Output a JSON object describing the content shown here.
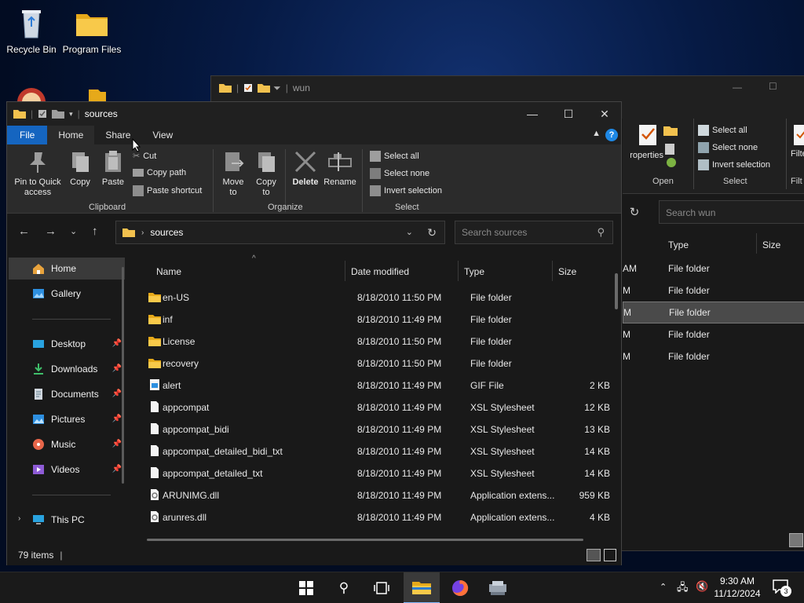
{
  "desktop": {
    "icons": [
      {
        "label": "Recycle Bin"
      },
      {
        "label": "Program Files"
      }
    ]
  },
  "bg_window": {
    "path": "wun",
    "ribbon": {
      "properties": "roperties",
      "open_label": "Open",
      "select_all": "Select all",
      "select_none": "Select none",
      "invert_selection": "Invert selection",
      "select_label": "Select",
      "filter": "Filte",
      "filter_group": "Filt"
    },
    "search_placeholder": "Search wun",
    "columns": {
      "type": "Type",
      "size": "Size"
    },
    "rows": [
      {
        "modified_tail": "AM",
        "type": "File folder"
      },
      {
        "modified_tail": "M",
        "type": "File folder"
      },
      {
        "modified_tail": "M",
        "type": "File folder"
      },
      {
        "modified_tail": "M",
        "type": "File folder"
      },
      {
        "modified_tail": "M",
        "type": "File folder"
      }
    ]
  },
  "window": {
    "title": "sources",
    "controls": {
      "minimize": "—",
      "maximize": "☐",
      "close": "✕"
    },
    "tabs": [
      {
        "label": "File"
      },
      {
        "label": "Home"
      },
      {
        "label": "Share"
      },
      {
        "label": "View"
      }
    ],
    "help": "?",
    "ribbon": {
      "pin": "Pin to Quick access",
      "copy": "Copy",
      "paste": "Paste",
      "cut": "Cut",
      "copy_path": "Copy path",
      "paste_shortcut": "Paste shortcut",
      "clipboard": "Clipboard",
      "move_to": "Move to",
      "copy_to": "Copy to",
      "delete": "Delete",
      "rename": "Rename",
      "organize": "Organize",
      "select_all": "Select all",
      "select_none": "Select none",
      "invert_selection": "Invert selection",
      "select": "Select"
    },
    "address": {
      "crumb": "sources"
    },
    "search": {
      "placeholder": "Search sources"
    },
    "nav_pane": {
      "items": [
        {
          "label": "Home"
        },
        {
          "label": "Gallery"
        },
        {
          "label": "Desktop"
        },
        {
          "label": "Downloads"
        },
        {
          "label": "Documents"
        },
        {
          "label": "Pictures"
        },
        {
          "label": "Music"
        },
        {
          "label": "Videos"
        },
        {
          "label": "This PC"
        }
      ]
    },
    "columns": {
      "name": "Name",
      "date": "Date modified",
      "type": "Type",
      "size": "Size"
    },
    "files": [
      {
        "name": "en-US",
        "date": "8/18/2010 11:50 PM",
        "type": "File folder",
        "size": "",
        "kind": "folder"
      },
      {
        "name": "inf",
        "date": "8/18/2010 11:49 PM",
        "type": "File folder",
        "size": "",
        "kind": "folder"
      },
      {
        "name": "License",
        "date": "8/18/2010 11:50 PM",
        "type": "File folder",
        "size": "",
        "kind": "folder"
      },
      {
        "name": "recovery",
        "date": "8/18/2010 11:50 PM",
        "type": "File folder",
        "size": "",
        "kind": "folder"
      },
      {
        "name": "alert",
        "date": "8/18/2010 11:49 PM",
        "type": "GIF File",
        "size": "2 KB",
        "kind": "image"
      },
      {
        "name": "appcompat",
        "date": "8/18/2010 11:49 PM",
        "type": "XSL Stylesheet",
        "size": "12 KB",
        "kind": "doc"
      },
      {
        "name": "appcompat_bidi",
        "date": "8/18/2010 11:49 PM",
        "type": "XSL Stylesheet",
        "size": "13 KB",
        "kind": "doc"
      },
      {
        "name": "appcompat_detailed_bidi_txt",
        "date": "8/18/2010 11:49 PM",
        "type": "XSL Stylesheet",
        "size": "14 KB",
        "kind": "doc"
      },
      {
        "name": "appcompat_detailed_txt",
        "date": "8/18/2010 11:49 PM",
        "type": "XSL Stylesheet",
        "size": "14 KB",
        "kind": "doc"
      },
      {
        "name": "ARUNIMG.dll",
        "date": "8/18/2010 11:49 PM",
        "type": "Application extens...",
        "size": "959 KB",
        "kind": "dll"
      },
      {
        "name": "arunres.dll",
        "date": "8/18/2010 11:49 PM",
        "type": "Application extens...",
        "size": "4 KB",
        "kind": "dll"
      }
    ],
    "status": {
      "count": "79 items"
    }
  },
  "taskbar": {
    "clock_time": "9:30 AM",
    "clock_date": "11/12/2024",
    "notification_count": "3"
  },
  "colors": {
    "accent": "#1565c0",
    "folder": "#f2c14e"
  }
}
